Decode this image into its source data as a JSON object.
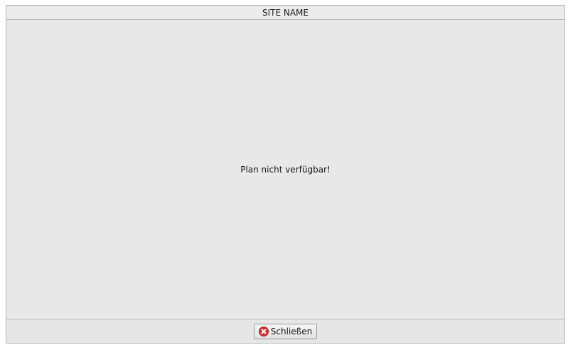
{
  "window": {
    "title": "SITE NAME"
  },
  "content": {
    "message": "Plan nicht verfügbar!"
  },
  "footer": {
    "close_button_label": "Schließen",
    "close_icon": "close-icon"
  },
  "colors": {
    "background": "#e8e8e8",
    "close_icon_red": "#d9302a"
  }
}
